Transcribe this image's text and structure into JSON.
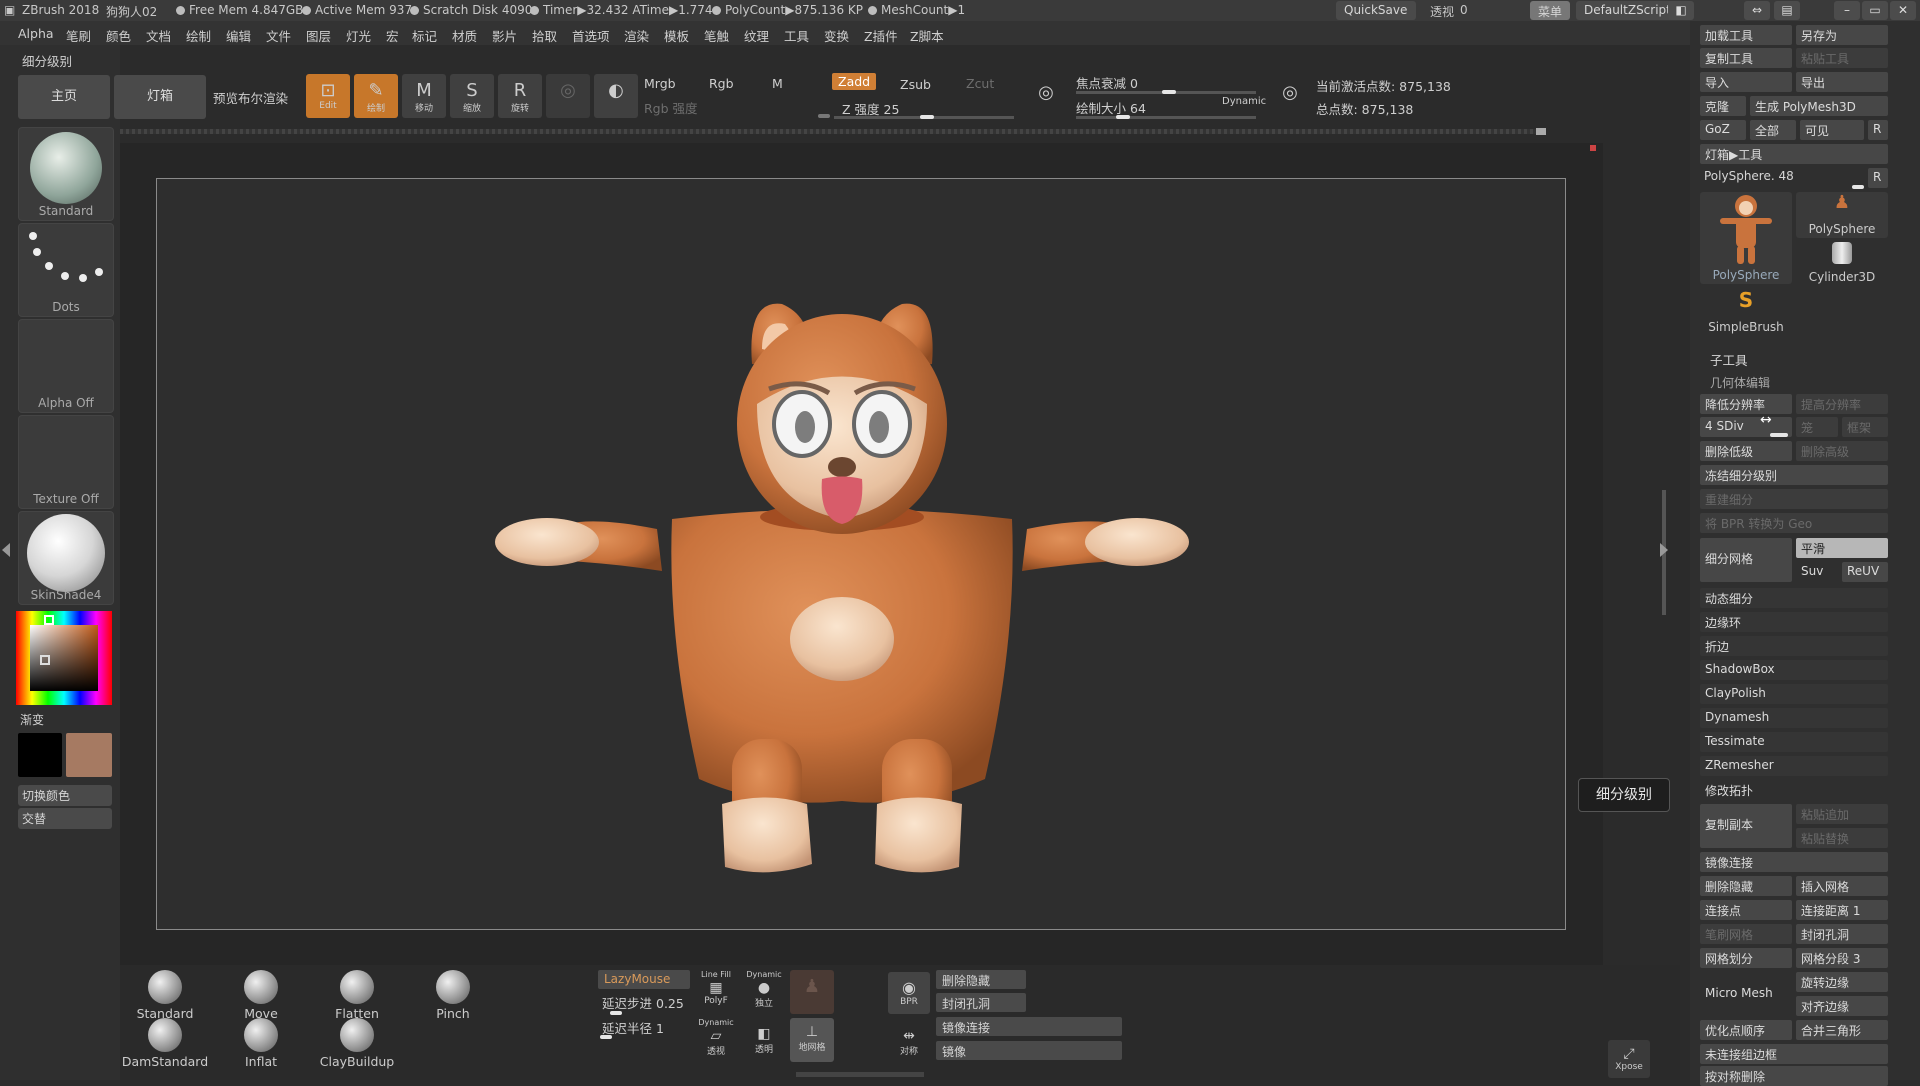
{
  "titlebar": {
    "app": "ZBrush 2018",
    "doc": "狗狗人02",
    "stats": [
      "Free Mem 4.847GB",
      "Active Mem 937",
      "Scratch Disk 4090",
      "Timer▶32.432 ATime▶1.774",
      "PolyCount▶875.136 KP",
      "MeshCount▶1"
    ],
    "quicksave": "QuickSave",
    "transparency_label": "透视",
    "transparency_value": "0",
    "menu_btn": "菜单",
    "script": "DefaultZScript"
  },
  "menu": [
    "Alpha",
    "笔刷",
    "颜色",
    "文档",
    "绘制",
    "编辑",
    "文件",
    "图层",
    "灯光",
    "宏",
    "标记",
    "材质",
    "影片",
    "拾取",
    "首选项",
    "渲染",
    "模板",
    "笔触",
    "纹理",
    "工具",
    "变换",
    "Z插件",
    "Z脚本"
  ],
  "leftpanel": {
    "section": "细分级别",
    "brush": "Standard",
    "stroke": "Dots",
    "alpha": "Alpha Off",
    "texture": "Texture Off",
    "material": "SkinShade4",
    "gradient": "渐变",
    "switch_color": "切换颜色",
    "alternate": "交替",
    "colors": {
      "primary": "#000000",
      "secondary": "#a67a62"
    }
  },
  "toolbar": {
    "home": "主页",
    "lightbox": "灯箱",
    "bpr_preview": "预览布尔渲染",
    "edit": "Edit",
    "draw": "绘制",
    "move": "移动",
    "scale": "缩放",
    "rotate": "旋转",
    "mrgb": "Mrgb",
    "rgb": "Rgb",
    "m": "M",
    "rgb_intensity": "Rgb 强度",
    "zadd": "Zadd",
    "zsub": "Zsub",
    "zcut": "Zcut",
    "z_intensity_label": "Z 强度",
    "z_intensity": "25",
    "focal_label": "焦点衰减",
    "focal": "0",
    "draw_size_label": "绘制大小",
    "draw_size": "64",
    "dynamic": "Dynamic",
    "active_points": "当前激活点数: 875,138",
    "total_points": "总点数: 875,138"
  },
  "bottombar": {
    "brushes": [
      "Standard",
      "Move",
      "Flatten",
      "Pinch",
      "DamStandard",
      "Inflat",
      "ClayBuildup"
    ],
    "lazymouse": "LazyMouse",
    "lazystep_label": "延迟步进",
    "lazystep": "0.25",
    "lazyradius_label": "延迟半径",
    "lazyradius": "1",
    "linefill": "Line Fill",
    "polyf": "PolyF",
    "dynamic": "Dynamic",
    "perspective": "透视",
    "solo": "独立",
    "transp": "透明",
    "floor": "地网格",
    "bpr": "BPR",
    "actions": [
      "删除隐藏",
      "封闭孔洞",
      "镜像连接",
      "镜像"
    ],
    "symmetry": "对称",
    "xpose": "Xpose"
  },
  "rightpanel": {
    "top": [
      "加载工具",
      "另存为",
      "复制工具",
      "粘贴工具",
      "导入",
      "导出",
      "克隆",
      "生成 PolyMesh3D",
      "GoZ",
      "全部",
      "可见",
      "R"
    ],
    "lightbox_tools": "灯箱▶工具",
    "current_tool": "PolySphere.",
    "current_tool_val": "48",
    "tools": [
      "PolySphere",
      "PolySphere",
      "Cylinder3D",
      "SimpleBrush"
    ],
    "subtool": "子工具",
    "geometry": "几何体编辑",
    "lower_res": "降低分辨率",
    "higher_res": "提高分辨率",
    "sdiv_label": "SDiv",
    "sdiv": "4",
    "cage": "笼",
    "rstr": "框架",
    "del_lower": "删除低级",
    "del_higher": "删除高级",
    "freeze": "冻结细分级别",
    "reconstruct": "重建细分",
    "bpr_geo": "将 BPR 转换为 Geo",
    "divide": "细分网格",
    "smooth": "平滑",
    "suv": "Suv",
    "reuv": "ReUV",
    "sections": [
      "动态细分",
      "边缘环",
      "折边",
      "ShadowBox",
      "ClayPolish",
      "Dynamesh",
      "Tessimate",
      "ZRemesher"
    ],
    "modify_topo": "修改拓扑",
    "copy": "复制副本",
    "paste_add": "粘贴追加",
    "paste_replace": "粘贴替换",
    "mirror_weld": "镜像连接",
    "del_hidden": "删除隐藏",
    "insert_mesh": "插入网格",
    "weld_pts": "连接点",
    "weld_dist_label": "连接距离",
    "weld_dist": "1",
    "mesh_from_brush": "笔刷网格",
    "close_holes": "封闭孔洞",
    "grid_divide": "网格划分",
    "grid_segments_label": "网格分段",
    "grid_segments": "3",
    "micromesh": "Micro Mesh",
    "spin_edge": "旋转边缘",
    "align_edge": "对齐边缘",
    "optimize": "优化点顺序",
    "merge_tris": "合并三角形",
    "unweld": "未连接组边框",
    "delete_by_sym": "按对称删除"
  },
  "tooltip": "细分级别"
}
